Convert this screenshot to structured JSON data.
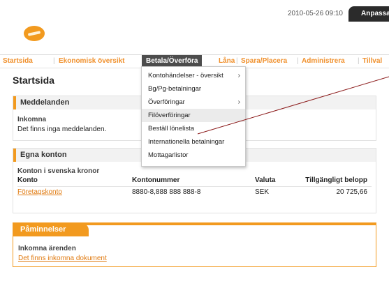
{
  "header": {
    "datetime": "2010-05-26 09:10",
    "customize_label": "Anpassa"
  },
  "nav": {
    "items": [
      {
        "label": "Startsida"
      },
      {
        "label": "Ekonomisk översikt"
      },
      {
        "label": "Betala/Överföra"
      },
      {
        "label": "Låna"
      },
      {
        "label": "Spara/Placera"
      },
      {
        "label": "Administrera"
      },
      {
        "label": "Tillval"
      }
    ],
    "active": "Betala/Överföra",
    "accent_color": "#f0902c"
  },
  "page": {
    "title": "Startsida"
  },
  "messages": {
    "title": "Meddelanden",
    "subtitle": "Inkomna",
    "text": "Det finns inga meddelanden."
  },
  "accounts": {
    "title": "Egna konton",
    "section": "Konton i svenska kronor",
    "columns": [
      "Konto",
      "Kontonummer",
      "Valuta",
      "Tillgängligt belopp"
    ],
    "rows": [
      {
        "name": "Företagskonto",
        "number": "8880-8,888 888 888-8",
        "currency": "SEK",
        "amount": "20 725,66"
      }
    ]
  },
  "reminders": {
    "title": "Påminnelser",
    "subtitle": "Inkomna ärenden",
    "link": "Det finns inkomna dokument"
  },
  "dropdown": {
    "items": [
      {
        "label": "Kontohändelser - översikt",
        "submenu": true,
        "arrow": "›"
      },
      {
        "label": "Bg/Pg-betalningar",
        "submenu": false,
        "arrow": ""
      },
      {
        "label": "Överföringar",
        "submenu": true,
        "arrow": "›"
      },
      {
        "label": "Filöverföringar",
        "submenu": false,
        "arrow": "",
        "highlighted": true
      },
      {
        "label": "Beställ lönelista",
        "submenu": false,
        "arrow": ""
      },
      {
        "label": "Internationella betalningar",
        "submenu": false,
        "arrow": ""
      },
      {
        "label": "Mottagarlistor",
        "submenu": false,
        "arrow": ""
      }
    ]
  },
  "colors": {
    "brand_orange": "#f29a1f",
    "annotation_line": "#8b1a1a"
  }
}
